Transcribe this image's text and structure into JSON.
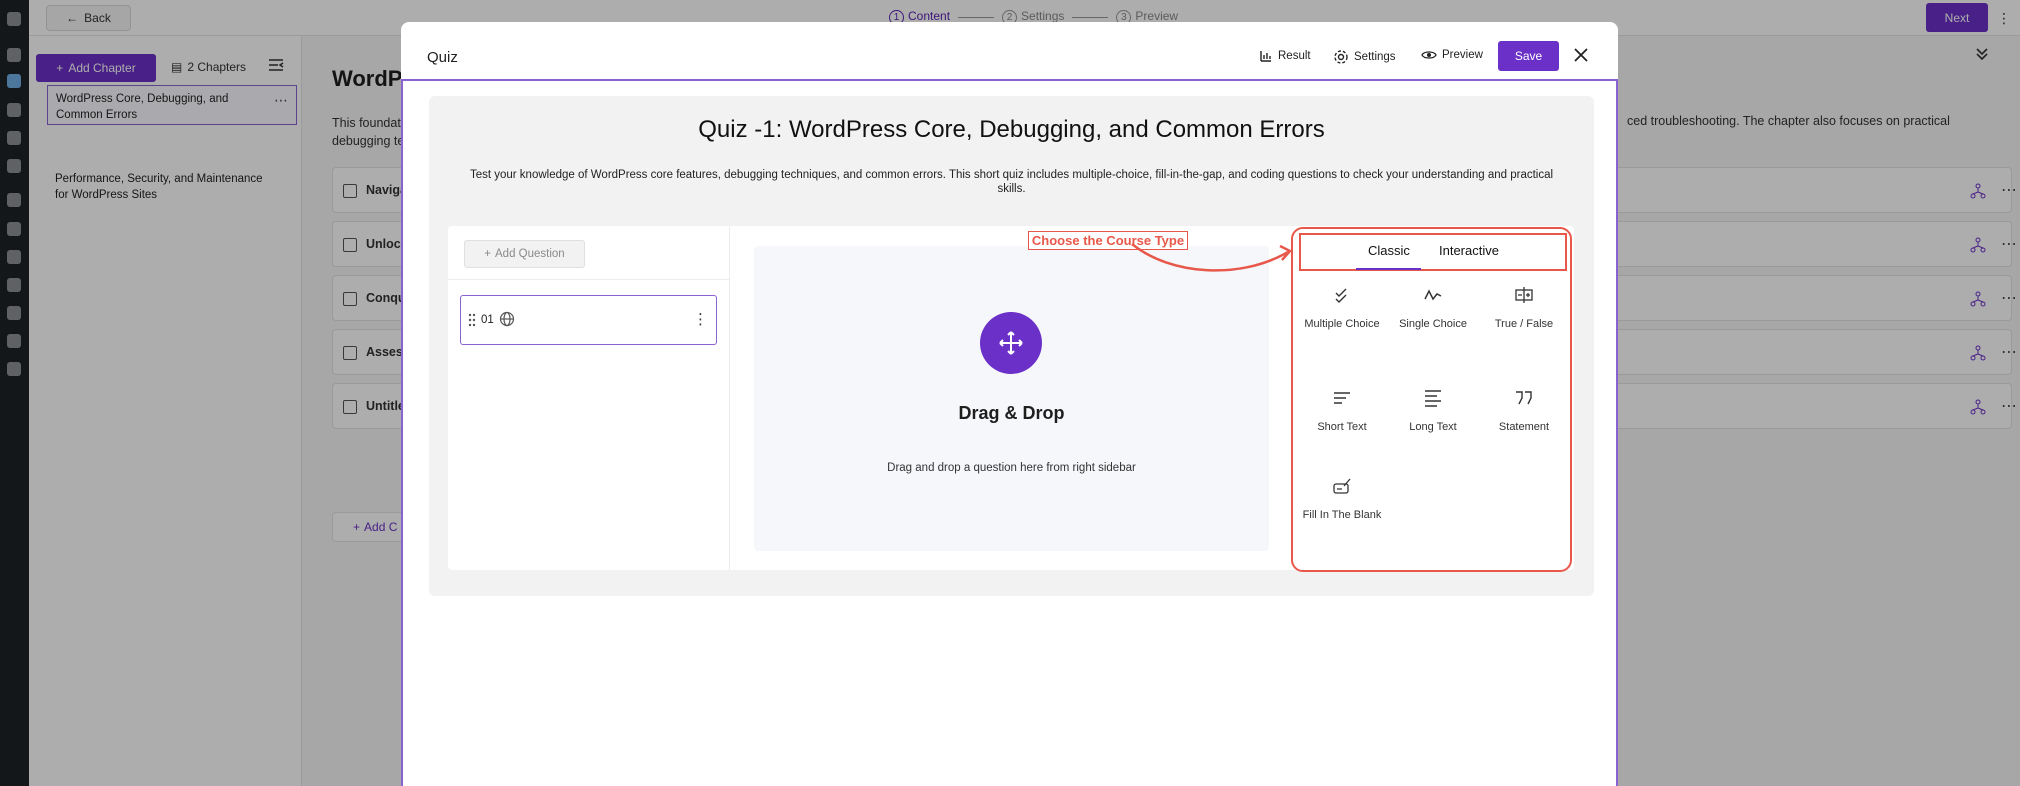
{
  "topbar": {
    "back_label": "Back",
    "steps": [
      {
        "num": "1",
        "label": "Content"
      },
      {
        "num": "2",
        "label": "Settings"
      },
      {
        "num": "3",
        "label": "Preview"
      }
    ],
    "next_label": "Next"
  },
  "left_panel": {
    "add_chapter_label": "Add Chapter",
    "chapters_count": "2 Chapters",
    "chapters": [
      {
        "title": "WordPress Core, Debugging, and Common Errors"
      },
      {
        "title": "Performance, Security, and Maintenance for WordPress Sites"
      }
    ]
  },
  "main": {
    "title": "WordPr",
    "desc_left": "This foundat",
    "desc_left_2": "debugging te",
    "desc_right": "ced troubleshooting. The chapter also focuses on practical",
    "lessons": [
      {
        "label": "Navigat"
      },
      {
        "label": "Unlock"
      },
      {
        "label": "Conqu"
      },
      {
        "label": "Assess"
      },
      {
        "label": "Untitle"
      }
    ],
    "add_content_label": "Add C"
  },
  "modal": {
    "title": "Quiz",
    "result_label": "Result",
    "settings_label": "Settings",
    "preview_label": "Preview",
    "save_label": "Save",
    "quiz_title": "Quiz -1: WordPress Core, Debugging, and Common Errors",
    "quiz_desc": "Test your knowledge of WordPress core features, debugging techniques, and common errors. This short quiz includes multiple-choice, fill-in-the-gap, and coding questions to check your understanding and practical skills.",
    "add_question_label": "Add Question",
    "question_number": "01",
    "drop_title": "Drag & Drop",
    "drop_sub": "Drag and drop a question here from right sidebar",
    "annotation": "Choose the Course Type",
    "tabs": [
      "Classic",
      "Interactive"
    ],
    "question_types": [
      {
        "label": "Multiple Choice",
        "icon": "multiple-choice-icon"
      },
      {
        "label": "Single Choice",
        "icon": "single-choice-icon"
      },
      {
        "label": "True / False",
        "icon": "true-false-icon"
      },
      {
        "label": "Short Text",
        "icon": "short-text-icon"
      },
      {
        "label": "Long Text",
        "icon": "long-text-icon"
      },
      {
        "label": "Statement",
        "icon": "quote-icon"
      },
      {
        "label": "Fill In The Blank",
        "icon": "fill-blank-icon"
      }
    ]
  },
  "colors": {
    "accent": "#6b30c8",
    "annotation": "#e8584a",
    "wp_sidebar": "#1d2327"
  }
}
